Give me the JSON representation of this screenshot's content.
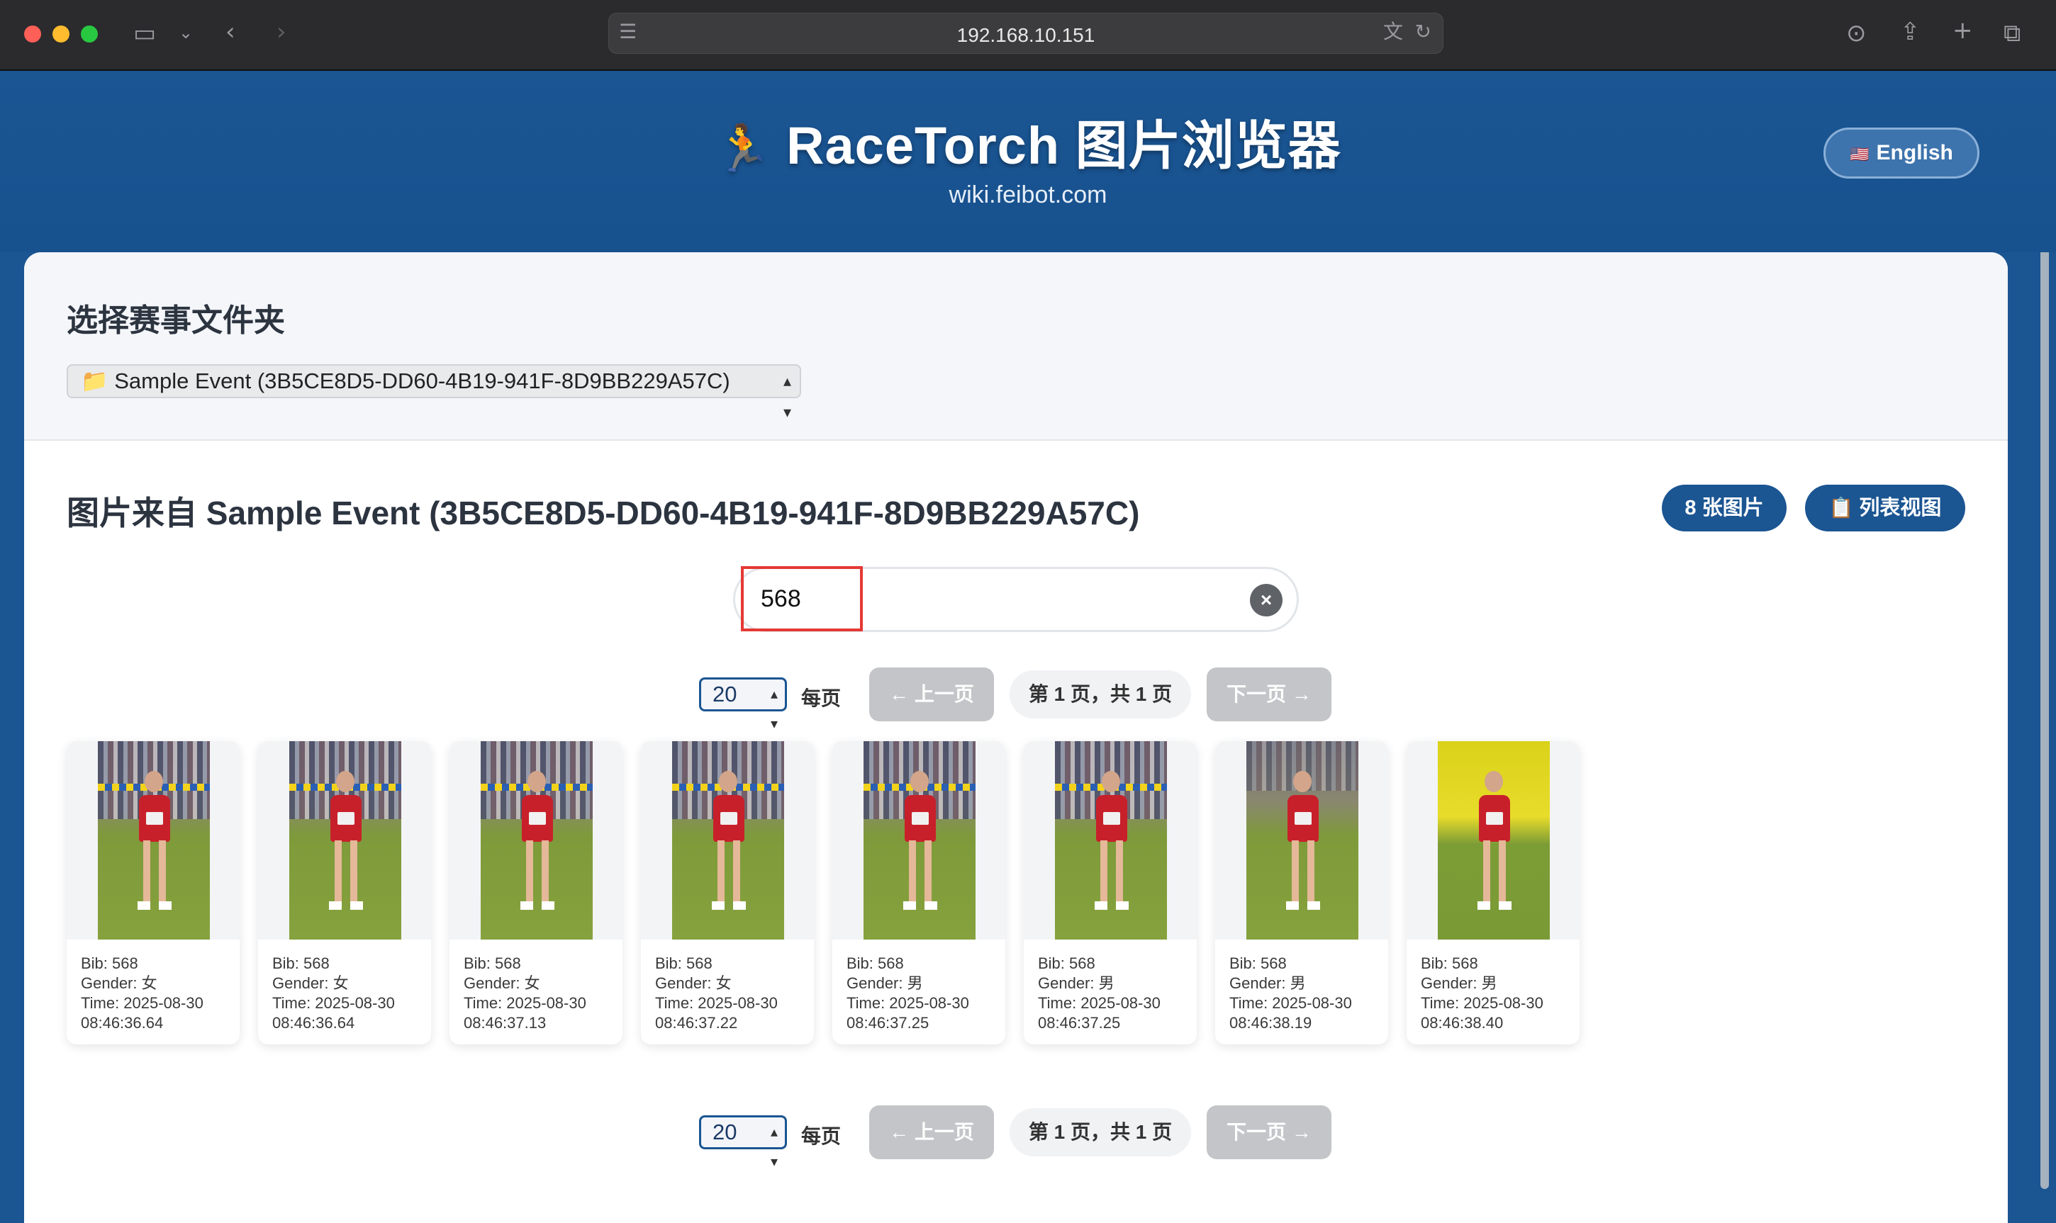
{
  "browser": {
    "url": "192.168.10.151"
  },
  "header": {
    "icon": "🏃",
    "title": "RaceTorch 图片浏览器",
    "subtitle": "wiki.feibot.com",
    "language_flag": "🇺🇸",
    "language_label": "English"
  },
  "folder": {
    "heading": "选择赛事文件夹",
    "icon": "📁",
    "selected": "Sample Event (3B5CE8D5-DD60-4B19-941F-8D9BB229A57C)"
  },
  "gallery": {
    "title": "图片来自 Sample Event (3B5CE8D5-DD60-4B19-941F-8D9BB229A57C)",
    "count_label": "8 张图片",
    "view_icon": "📋",
    "view_label": "列表视图"
  },
  "search": {
    "value": "568",
    "clear_symbol": "×"
  },
  "pagination": {
    "per_page_value": "20",
    "per_page_label": "每页",
    "prev_label": "← 上一页",
    "page_info": "第 1 页，共 1 页",
    "next_label": "下一页 →"
  },
  "photos": [
    {
      "bib": "Bib: 568",
      "gender": "Gender: 女",
      "time_date": "Time: 2025-08-30",
      "time_clock": "08:46:36.64"
    },
    {
      "bib": "Bib: 568",
      "gender": "Gender: 女",
      "time_date": "Time: 2025-08-30",
      "time_clock": "08:46:36.64"
    },
    {
      "bib": "Bib: 568",
      "gender": "Gender: 女",
      "time_date": "Time: 2025-08-30",
      "time_clock": "08:46:37.13"
    },
    {
      "bib": "Bib: 568",
      "gender": "Gender: 女",
      "time_date": "Time: 2025-08-30",
      "time_clock": "08:46:37.22"
    },
    {
      "bib": "Bib: 568",
      "gender": "Gender: 男",
      "time_date": "Time: 2025-08-30",
      "time_clock": "08:46:37.25"
    },
    {
      "bib": "Bib: 568",
      "gender": "Gender: 男",
      "time_date": "Time: 2025-08-30",
      "time_clock": "08:46:37.25"
    },
    {
      "bib": "Bib: 568",
      "gender": "Gender: 男",
      "time_date": "Time: 2025-08-30",
      "time_clock": "08:46:38.19"
    },
    {
      "bib": "Bib: 568",
      "gender": "Gender: 男",
      "time_date": "Time: 2025-08-30",
      "time_clock": "08:46:38.40"
    }
  ]
}
